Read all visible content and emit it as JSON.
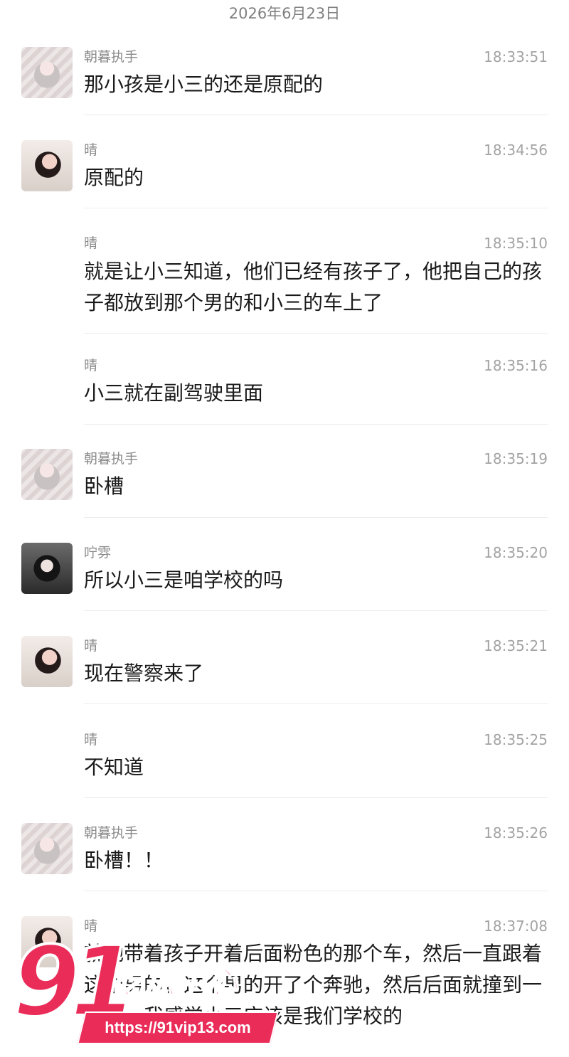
{
  "date_header": "2026年6月23日",
  "messages": [
    {
      "sender": "朝暮执手",
      "time": "18:33:51",
      "text": "那小孩是小三的还是原配的",
      "avatar": "avatar-anime-girl"
    },
    {
      "sender": "晴",
      "time": "18:34:56",
      "text": "原配的",
      "avatar": "avatar-qing"
    },
    {
      "sender": "晴",
      "time": "18:35:10",
      "text": "就是让小三知道，他们已经有孩子了，他把自己的孩子都放到那个男的和小三的车上了",
      "avatar": ""
    },
    {
      "sender": "晴",
      "time": "18:35:16",
      "text": "小三就在副驾驶里面",
      "avatar": ""
    },
    {
      "sender": "朝暮执手",
      "time": "18:35:19",
      "text": "卧槽",
      "avatar": "avatar-anime-girl"
    },
    {
      "sender": "咛雰",
      "time": "18:35:20",
      "text": "所以小三是咱学校的吗",
      "avatar": "avatar-ning"
    },
    {
      "sender": "晴",
      "time": "18:35:21",
      "text": "现在警察来了",
      "avatar": "avatar-qing"
    },
    {
      "sender": "晴",
      "time": "18:35:25",
      "text": "不知道",
      "avatar": ""
    },
    {
      "sender": "朝暮执手",
      "time": "18:35:26",
      "text": "卧槽！！",
      "avatar": "avatar-anime-girl"
    },
    {
      "sender": "晴",
      "time": "18:37:08",
      "text": "就她带着孩子开着后面粉色的那个车，然后一直跟着这个男的，这个男的开了个奔驰，然后后面就撞到一起了，我感觉小三应该是我们学校的",
      "avatar": "avatar-qing"
    }
  ],
  "watermark": {
    "number": "91",
    "name": "吃瓜中心",
    "url": "https://91vip13.com"
  }
}
